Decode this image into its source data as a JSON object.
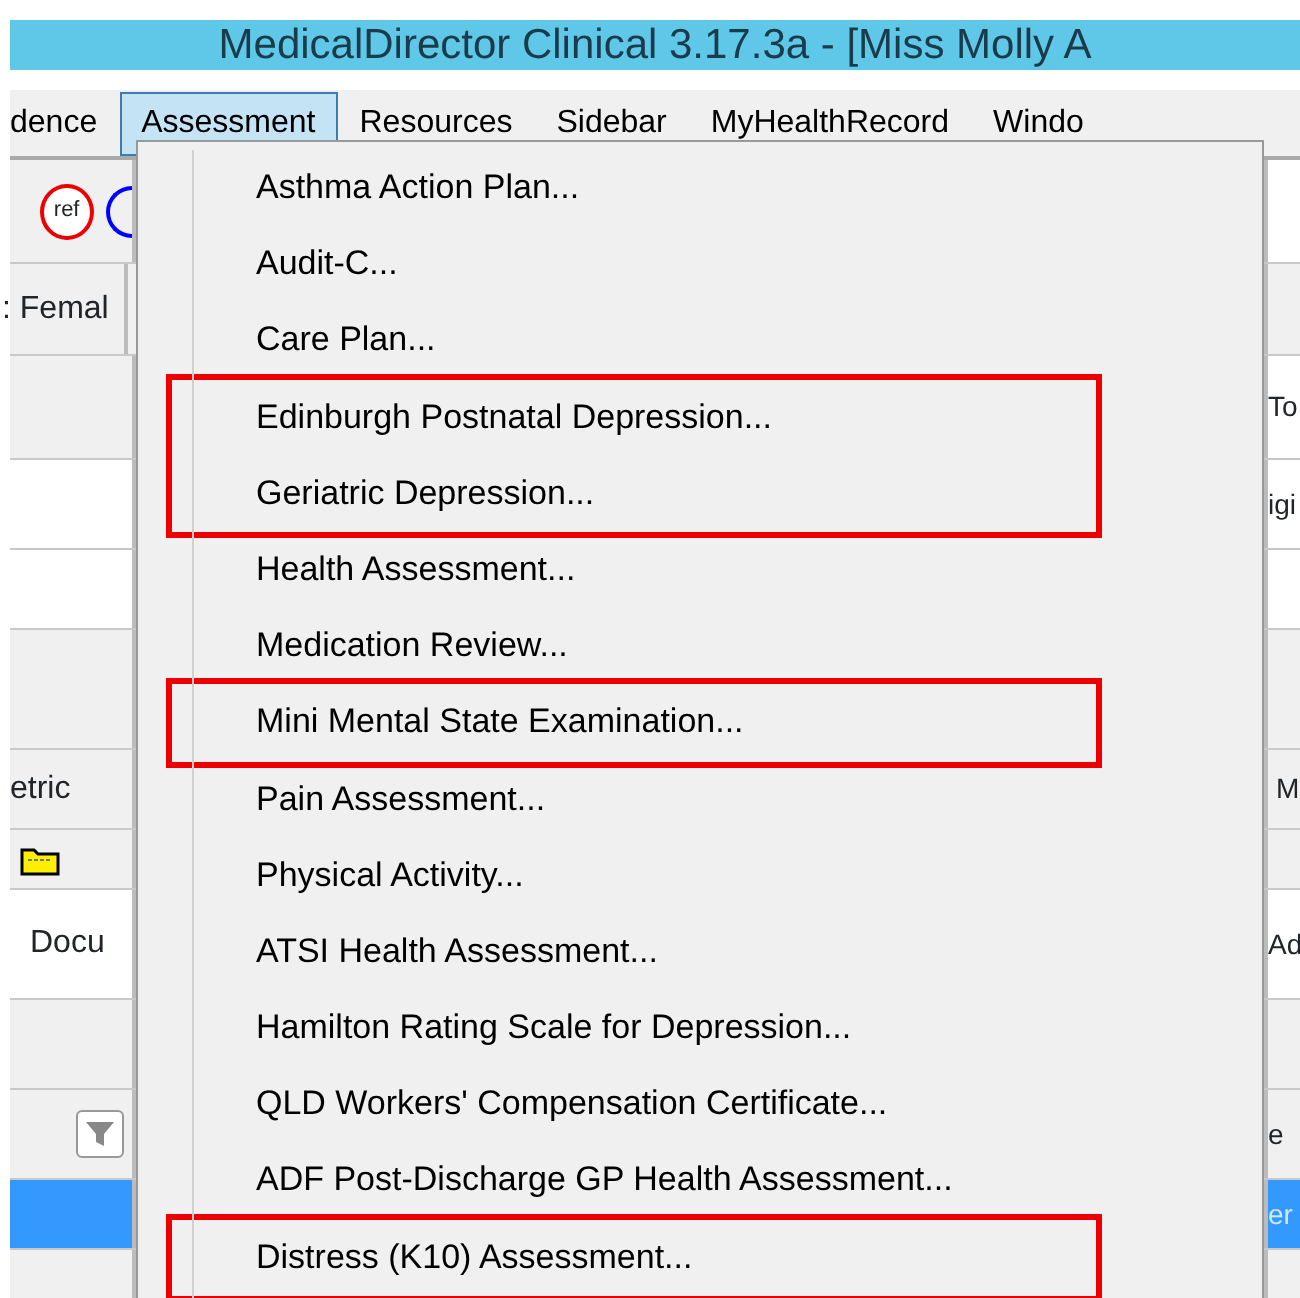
{
  "window": {
    "title": "MedicalDirector Clinical 3.17.3a - [Miss Molly A"
  },
  "menubar": [
    {
      "label": "dence",
      "selected": false
    },
    {
      "label": "Assessment",
      "selected": true
    },
    {
      "label": "Resources",
      "selected": false
    },
    {
      "label": "Sidebar",
      "selected": false
    },
    {
      "label": "MyHealthRecord",
      "selected": false
    },
    {
      "label": "Windo",
      "selected": false
    }
  ],
  "toolbar": {
    "ref_badge": "ref"
  },
  "left_fragments": {
    "sex": ": Femal",
    "column": "etric",
    "tab": "Docu",
    "selected_row": true
  },
  "right_fragments": {
    "label_1": "To",
    "label_2": "igi",
    "column": "M",
    "tab": "Ad",
    "header": "e",
    "selected_row_text": "er"
  },
  "menu": {
    "items": [
      {
        "label": "Asthma Action Plan...",
        "boxed": false
      },
      {
        "label": "Audit-C...",
        "boxed": false
      },
      {
        "label": "Care Plan...",
        "boxed": false
      },
      {
        "label": "Edinburgh Postnatal Depression...",
        "boxed": true
      },
      {
        "label": "Geriatric Depression...",
        "boxed": true
      },
      {
        "label": "Health Assessment...",
        "boxed": false
      },
      {
        "label": "Medication Review...",
        "boxed": false
      },
      {
        "label": "Mini Mental State Examination...",
        "boxed": true
      },
      {
        "label": "Pain Assessment...",
        "boxed": false
      },
      {
        "label": "Physical Activity...",
        "boxed": false
      },
      {
        "label": "ATSI Health Assessment...",
        "boxed": false
      },
      {
        "label": "Hamilton Rating Scale for Depression...",
        "boxed": false
      },
      {
        "label": "QLD Workers' Compensation Certificate...",
        "boxed": false
      },
      {
        "label": "ADF Post-Discharge GP Health Assessment...",
        "boxed": false
      },
      {
        "label": "Distress (K10) Assessment...",
        "boxed": true
      }
    ]
  }
}
